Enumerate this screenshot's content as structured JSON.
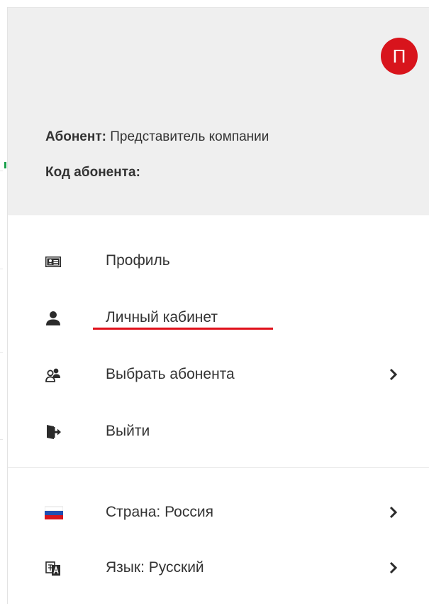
{
  "header": {
    "avatar_letter": "П"
  },
  "account": {
    "subscriber_label": "Абонент:",
    "subscriber_value": "Представитель компании",
    "code_label": "Код абонента:",
    "code_value": ""
  },
  "menu": {
    "items": [
      {
        "label": "Профиль",
        "icon": "id-card-icon"
      },
      {
        "label": "Личный кабинет",
        "icon": "user-icon"
      },
      {
        "label": "Выбрать абонента",
        "icon": "switch-user-icon"
      },
      {
        "label": "Выйти",
        "icon": "logout-icon"
      }
    ]
  },
  "settings": {
    "items": [
      {
        "label": "Страна: Россия",
        "icon": "russia-flag-icon"
      },
      {
        "label": "Язык: Русский",
        "icon": "language-icon"
      }
    ]
  },
  "colors": {
    "accent_red": "#d8141c",
    "header_bg": "#efefef",
    "underline": "#e0101a"
  }
}
